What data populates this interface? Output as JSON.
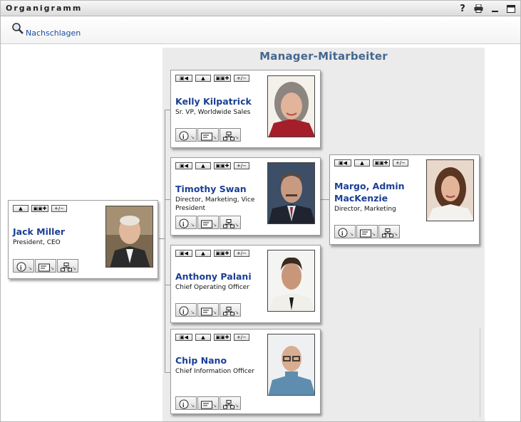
{
  "window": {
    "title": "Organigramm",
    "icons": [
      "help-icon",
      "print-icon",
      "minimize-icon",
      "maximize-icon"
    ]
  },
  "toolbar": {
    "lookup_label": "Nachschlagen",
    "lookup_icon": "magnifier-icon"
  },
  "panel": {
    "title": "Manager-Mitarbeiter"
  },
  "buttons": {
    "back": "▣◀",
    "up": "▲",
    "expand": "▣▣✚",
    "toggle": "+/−",
    "info_icon": "info-icon",
    "card_icon": "vcard-icon",
    "orgchart_icon": "orgchart-icon"
  },
  "colors": {
    "name_link": "#1a3f95",
    "panel_title": "#44688f",
    "panel_bg": "#ebebeb"
  },
  "people": {
    "root": {
      "name": "Jack Miller",
      "title": "President, CEO"
    },
    "reports": [
      {
        "name": "Kelly Kilpatrick",
        "title": "Sr. VP, Worldwide Sales"
      },
      {
        "name": "Timothy Swan",
        "title": "Director, Marketing, Vice President"
      },
      {
        "name": "Anthony Palani",
        "title": "Chief Operating Officer"
      },
      {
        "name": "Chip Nano",
        "title": "Chief Information Officer"
      }
    ],
    "sub": {
      "name": "Margo, Admin MacKenzie",
      "title": "Director, Marketing"
    }
  }
}
